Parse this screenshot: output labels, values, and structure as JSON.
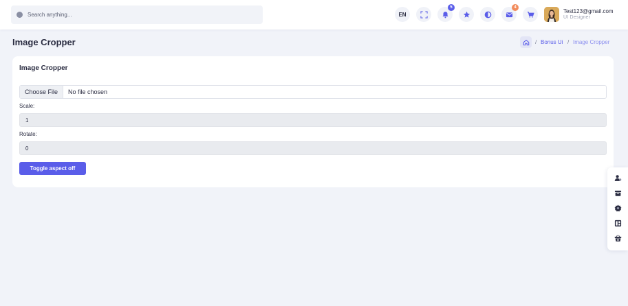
{
  "header": {
    "search_placeholder": "Search anything...",
    "language": "EN",
    "notifications_count": "5",
    "messages_count": "4",
    "icons": [
      "fullscreen-icon",
      "bell-icon",
      "star-icon",
      "theme-toggle-icon",
      "mail-icon",
      "cart-icon"
    ],
    "user": {
      "email": "Test123@gmail.com",
      "role": "UI Designer"
    }
  },
  "page": {
    "title": "Image Cropper",
    "breadcrumb": {
      "separator": "/",
      "link": "Bonus Ui",
      "current": "Image Cropper"
    }
  },
  "card": {
    "title": "Image Cropper",
    "file_button": "Choose File",
    "file_status": "No file chosen",
    "scale_label": "Scale:",
    "scale_value": "1",
    "rotate_label": "Rotate:",
    "rotate_value": "0",
    "toggle_button": "Toggle aspect off"
  },
  "side_panel": {
    "icons": [
      "user-settings-icon",
      "box-icon",
      "gear-icon",
      "layout-icon",
      "basket-icon"
    ]
  },
  "colors": {
    "accent": "#5a5de9",
    "badge_orange": "#f28c5c",
    "page_bg": "#f1f3f9"
  }
}
